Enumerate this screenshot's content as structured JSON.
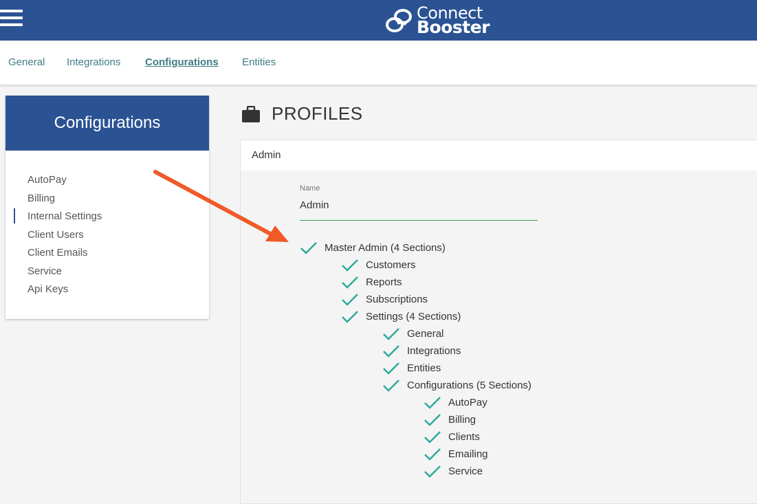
{
  "header": {
    "logo_line1": "Connect",
    "logo_line2": "Booster",
    "bar_color": "#2b5393"
  },
  "tabs": [
    {
      "label": "General"
    },
    {
      "label": "Integrations"
    },
    {
      "label": "Configurations",
      "active": true
    },
    {
      "label": "Entities"
    }
  ],
  "sidebar": {
    "title": "Configurations",
    "items": [
      {
        "label": "AutoPay"
      },
      {
        "label": "Billing"
      },
      {
        "label": "Internal Settings",
        "active": true
      },
      {
        "label": "Client Users"
      },
      {
        "label": "Client Emails"
      },
      {
        "label": "Service"
      },
      {
        "label": "Api Keys"
      }
    ]
  },
  "main": {
    "title": "PROFILES",
    "profile": {
      "header": "Admin",
      "name_label": "Name",
      "name_value": "Admin"
    },
    "permissions": [
      {
        "label": "Master Admin (4 Sections)",
        "checked": true
      },
      {
        "label": "Customers",
        "checked": true
      },
      {
        "label": "Reports",
        "checked": true
      },
      {
        "label": "Subscriptions",
        "checked": true
      },
      {
        "label": "Settings (4 Sections)",
        "checked": true
      },
      {
        "label": "General",
        "checked": true
      },
      {
        "label": "Integrations",
        "checked": true
      },
      {
        "label": "Entities",
        "checked": true
      },
      {
        "label": "Configurations (5 Sections)",
        "checked": true
      },
      {
        "label": "AutoPay",
        "checked": true
      },
      {
        "label": "Billing",
        "checked": true
      },
      {
        "label": "Clients",
        "checked": true
      },
      {
        "label": "Emailing",
        "checked": true
      },
      {
        "label": "Service",
        "checked": true
      }
    ]
  },
  "colors": {
    "accent": "#2b5393",
    "tab_text": "#3f7c86",
    "check": "#2fa89b",
    "arrow": "#f05a28"
  }
}
